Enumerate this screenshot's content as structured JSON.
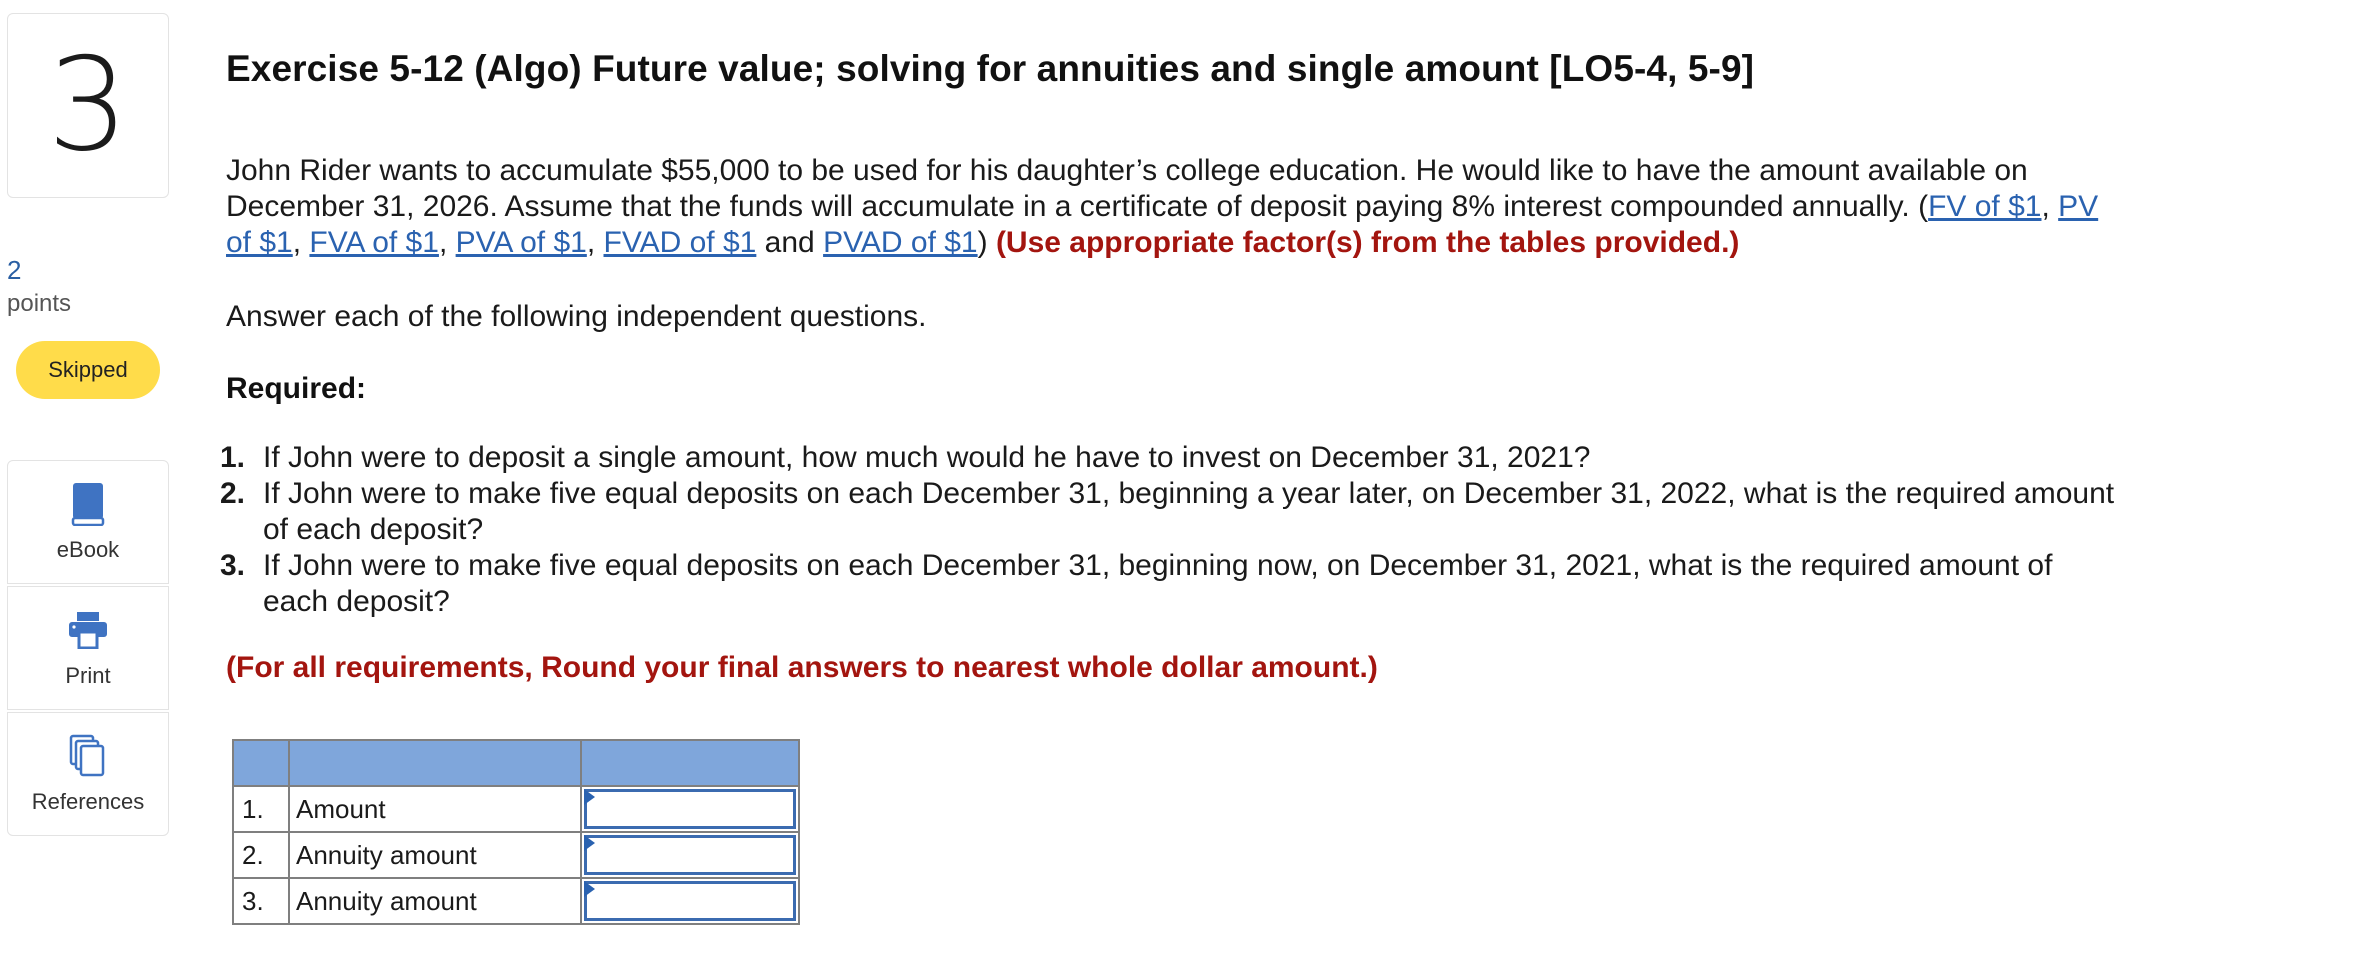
{
  "question": {
    "number": "3",
    "points_value": "2",
    "points_label": "points",
    "status_badge": "Skipped"
  },
  "tools": [
    {
      "label": "eBook",
      "icon": "book-icon"
    },
    {
      "label": "Print",
      "icon": "printer-icon"
    },
    {
      "label": "References",
      "icon": "copy-pages-icon"
    }
  ],
  "content": {
    "title": "Exercise 5-12 (Algo) Future value; solving for annuities and single amount [LO5-4, 5-9]",
    "intro": "John Rider wants to accumulate $55,000 to be used for his daughter’s college education. He would like to have the amount available on December 31, 2026. Assume that the funds will accumulate in a certificate of deposit paying 8% interest compounded annually. (",
    "links": [
      "FV of $1",
      "PV of $1",
      "FVA of $1",
      "PVA of $1",
      "FVAD of $1",
      "PVAD of $1"
    ],
    "sep_comma": ", ",
    "sep_and": " and ",
    "close_paren": ") ",
    "table_note": "(Use appropriate factor(s) from the tables provided.)",
    "answer_each": "Answer each of the following independent questions.",
    "required_label": "Required:",
    "requirements": [
      {
        "num": "1.",
        "text": "If John were to deposit a single amount, how much would he have to invest on December 31, 2021?"
      },
      {
        "num": "2.",
        "text": "If John were to make five equal deposits on each December 31, beginning a year later, on December 31, 2022, what is the required amount of each deposit?"
      },
      {
        "num": "3.",
        "text": "If John were to make five equal deposits on each December 31, beginning now, on December 31, 2021, what is the required amount of each deposit?"
      }
    ],
    "rounding_note": "(For all requirements, Round your final answers to nearest whole dollar amount.)"
  },
  "answer_table": {
    "header": [
      "",
      "",
      ""
    ],
    "rows": [
      {
        "num": "1.",
        "label": "Amount",
        "value": ""
      },
      {
        "num": "2.",
        "label": "Annuity amount",
        "value": ""
      },
      {
        "num": "3.",
        "label": "Annuity amount",
        "value": ""
      }
    ]
  },
  "colors": {
    "link": "#2a62b0",
    "emphasis_red": "#a3150f",
    "badge_yellow": "#ffdc4a",
    "table_header": "#7fa6db",
    "icon_blue": "#3f73c2"
  }
}
